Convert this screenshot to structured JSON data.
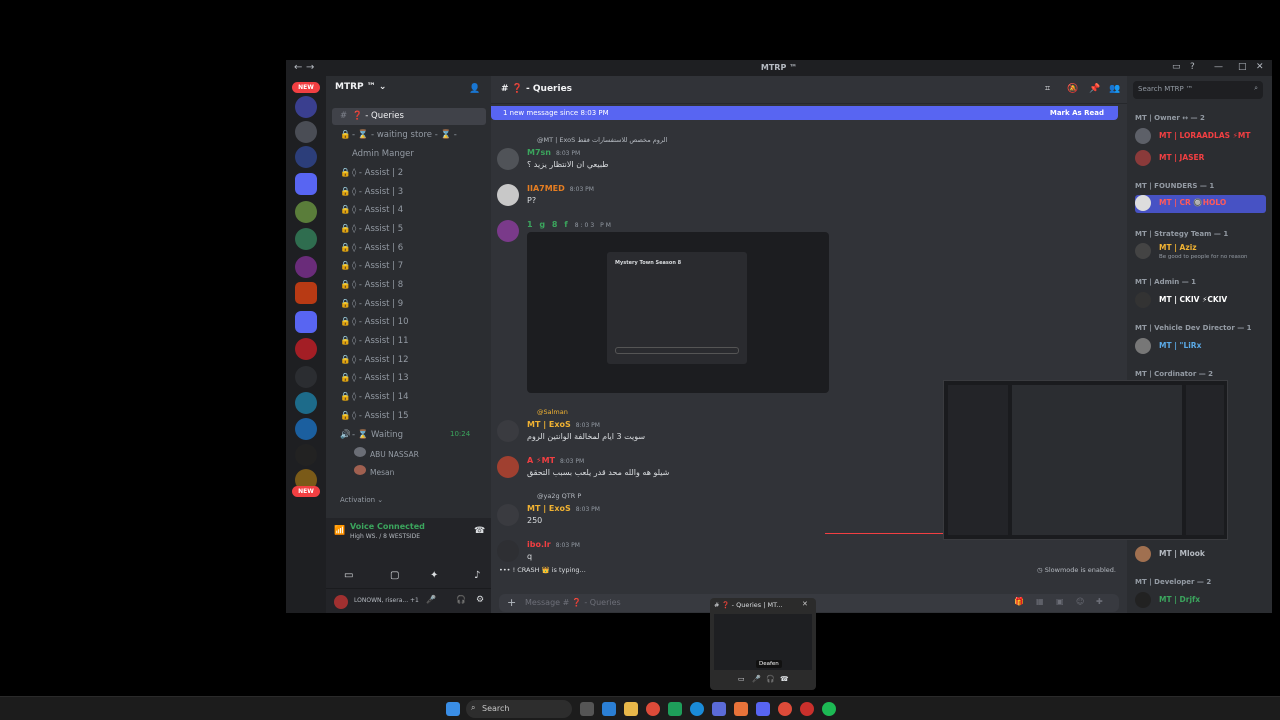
{
  "window": {
    "title": "MTRP ™"
  },
  "server": {
    "name": "MTRP ™"
  },
  "channels": [
    {
      "label": "❓ - Queries",
      "active": true
    },
    {
      "label": "- ⌛ - waiting store - ⌛ -"
    },
    {
      "label": "Admin Manger"
    },
    {
      "label": "◊ - Assist | 2"
    },
    {
      "label": "◊ - Assist | 3"
    },
    {
      "label": "◊ - Assist | 4"
    },
    {
      "label": "◊ - Assist | 5"
    },
    {
      "label": "◊ - Assist | 6"
    },
    {
      "label": "◊ - Assist | 7"
    },
    {
      "label": "◊ - Assist | 8"
    },
    {
      "label": "◊ - Assist | 9"
    },
    {
      "label": "◊ - Assist | 10"
    },
    {
      "label": "◊ - Assist | 11"
    },
    {
      "label": "◊ - Assist | 12"
    },
    {
      "label": "◊ - Assist | 13"
    },
    {
      "label": "◊ - Assist | 14"
    },
    {
      "label": "◊ - Assist | 15"
    }
  ],
  "voice_waiting": {
    "label": "- ⌛ Waiting",
    "timer": "10:24",
    "users": [
      "ABU NASSAR",
      "Mesan"
    ],
    "activation": "Activation"
  },
  "voice_status": {
    "title": "Voice Connected",
    "sub": "High WS. / 8 WESTSIDE"
  },
  "user_panel": {
    "name": "LONOWN, risera...",
    "extra": "+1"
  },
  "chat": {
    "header": "❓ - Queries",
    "new_messages": "1 new message since 8:03 PM",
    "mark_read": "Mark As Read",
    "input_placeholder": "Message # ❓ - Queries",
    "slowmode": "Slowmode is enabled.",
    "typing": "! CRASH 👑 is typing...",
    "messages": [
      {
        "reply": "@MT | ExoS الروم مخصص للاستفسارات فقط",
        "user": "M7sn",
        "time": "8:03 PM",
        "text": "طبيعي ان الانتظار يزيد ؟",
        "color": "#3ba55d"
      },
      {
        "user": "IIA7MED",
        "time": "8:03 PM",
        "text": "P?",
        "color": "#e67e22"
      },
      {
        "user": "1 g 8 f",
        "time": "8:03 PM",
        "text": "",
        "color": "#3ba55d"
      },
      {
        "reply": "@Salman",
        "user": "MT | ExoS",
        "time": "8:03 PM",
        "text": "سويت 3 ايام لمخالفة الوانتين الروم",
        "color": "#f0b232"
      },
      {
        "user": "A ⚡MT",
        "time": "8:03 PM",
        "text": "شيلو هه والله محد قدر يلعب بسبب التحقق",
        "color": "#f23f42"
      },
      {
        "reply": "@ya2g QTR P",
        "user": "MT | ExoS",
        "time": "8:03 PM",
        "text": "250",
        "color": "#f0b232"
      },
      {
        "user": "ibo.lr",
        "time": "8:03 PM",
        "text": "q",
        "color": "#f23f42"
      }
    ],
    "embed_title": "Mystery Town Season 8"
  },
  "members": {
    "search_placeholder": "Search MTRP ™",
    "sections": [
      {
        "title": "MT | Owner ↔ — 2",
        "items": [
          "MT | LORAADLAS ⚡MT",
          "MT | JASER"
        ]
      },
      {
        "title": "MT | FOUNDERS — 1",
        "items": [
          "MT | CR 🔘HOLO"
        ]
      },
      {
        "title": "MT | Strategy Team — 1",
        "items": [
          "MT | Aziz"
        ]
      },
      {
        "title": "MT | Admin — 1",
        "items": [
          "MT | CKIV ⚡CKIV"
        ]
      },
      {
        "title": "MT | Vehicle Dev Director — 1",
        "items": [
          "MT | \"LiRx"
        ]
      },
      {
        "title": "MT | Cordinator — 2",
        "items": []
      },
      {
        "title": "MT | Developer — 2",
        "items": [
          "MT | Mlook",
          "MT | Drjfx"
        ]
      }
    ],
    "aziz_status": "Be good to people for no reason"
  },
  "taskbar": {
    "search": "Search"
  },
  "thumbnail": {
    "title": "# ❓ - Queries | MT...",
    "action": "Deafen"
  },
  "colors": {
    "accent": "#5865f2",
    "bg": "#313338",
    "sidebar": "#2b2d31",
    "rail": "#1e1f22"
  }
}
